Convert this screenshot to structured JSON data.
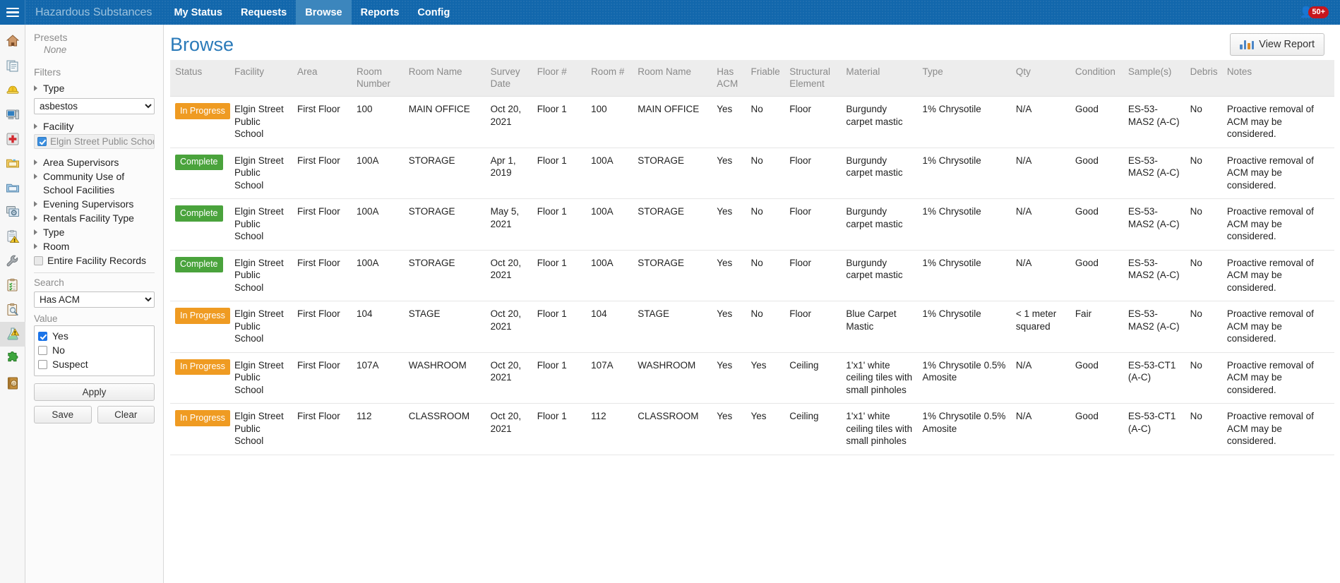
{
  "topbar": {
    "menu_icon": "hamburger-icon",
    "app_name": "Hazardous Substances",
    "nav": [
      {
        "label": "My Status",
        "active": false
      },
      {
        "label": "Requests",
        "active": false
      },
      {
        "label": "Browse",
        "active": true
      },
      {
        "label": "Reports",
        "active": false
      },
      {
        "label": "Config",
        "active": false
      }
    ],
    "user_badge": "50+",
    "brand_color": "#1267ac",
    "active_tab_color": "#3c86bd",
    "badge_color": "#c7161d"
  },
  "icon_rail": [
    {
      "name": "home-icon"
    },
    {
      "name": "documents-icon"
    },
    {
      "name": "hard-hat-icon"
    },
    {
      "name": "workstation-icon"
    },
    {
      "name": "first-aid-icon"
    },
    {
      "name": "yellow-folder-icon"
    },
    {
      "name": "blue-folder-icon"
    },
    {
      "name": "windows-settings-icon"
    },
    {
      "name": "clipboard-warning-icon"
    },
    {
      "name": "wrench-icon"
    },
    {
      "name": "clipboard-check-icon"
    },
    {
      "name": "clipboard-search-icon"
    },
    {
      "name": "hazard-flask-icon",
      "active": true
    },
    {
      "name": "puzzle-piece-icon"
    },
    {
      "name": "address-book-icon"
    }
  ],
  "filters": {
    "presets_heading": "Presets",
    "presets_value": "None",
    "filters_heading": "Filters",
    "type_node": "Type",
    "type_select_value": "asbestos",
    "type_select_options": [
      "asbestos"
    ],
    "facility_node": "Facility",
    "facility_selected": "Elgin Street Public School",
    "nodes": [
      "Area Supervisors",
      "Community Use of School Facilities",
      "Evening Supervisors",
      "Rentals Facility Type",
      "Type",
      "Room"
    ],
    "entire_facility_records": "Entire Facility Records",
    "search_label": "Search",
    "search_select_value": "Has ACM",
    "search_select_options": [
      "Has ACM"
    ],
    "value_label": "Value",
    "values": [
      {
        "label": "Yes",
        "checked": true
      },
      {
        "label": "No",
        "checked": false
      },
      {
        "label": "Suspect",
        "checked": false
      }
    ],
    "apply_label": "Apply",
    "save_label": "Save",
    "clear_label": "Clear"
  },
  "main": {
    "title": "Browse",
    "view_report_label": "View Report",
    "view_report_icon": "bar-chart-icon"
  },
  "table": {
    "columns": [
      "Status",
      "Facility",
      "Area",
      "Room Number",
      "Room Name",
      "Survey Date",
      "Floor #",
      "Room #",
      "Room Name",
      "Has ACM",
      "Friable",
      "Structural Element",
      "Material",
      "Type",
      "Qty",
      "Condition",
      "Sample(s)",
      "Debris",
      "Notes"
    ],
    "rows": [
      {
        "status": "In Progress",
        "status_kind": "inprogress",
        "facility": "Elgin Street Public School",
        "area": "First Floor",
        "room_number": "100",
        "room_name": "MAIN OFFICE",
        "survey_date": "Oct 20, 2021",
        "floor": "Floor 1",
        "room_hash": "100",
        "room_name2": "MAIN OFFICE",
        "has_acm": "Yes",
        "friable": "No",
        "structural_element": "Floor",
        "material": "Burgundy carpet mastic",
        "type": "1% Chrysotile",
        "qty": "N/A",
        "condition": "Good",
        "samples": "ES-53-MAS2 (A-C)",
        "debris": "No",
        "notes": "Proactive removal of ACM may be considered."
      },
      {
        "status": "Complete",
        "status_kind": "complete",
        "facility": "Elgin Street Public School",
        "area": "First Floor",
        "room_number": "100A",
        "room_name": "STORAGE",
        "survey_date": "Apr 1, 2019",
        "floor": "Floor 1",
        "room_hash": "100A",
        "room_name2": "STORAGE",
        "has_acm": "Yes",
        "friable": "No",
        "structural_element": "Floor",
        "material": "Burgundy carpet mastic",
        "type": "1% Chrysotile",
        "qty": "N/A",
        "condition": "Good",
        "samples": "ES-53-MAS2 (A-C)",
        "debris": "No",
        "notes": "Proactive removal of ACM may be considered."
      },
      {
        "status": "Complete",
        "status_kind": "complete",
        "facility": "Elgin Street Public School",
        "area": "First Floor",
        "room_number": "100A",
        "room_name": "STORAGE",
        "survey_date": "May 5, 2021",
        "floor": "Floor 1",
        "room_hash": "100A",
        "room_name2": "STORAGE",
        "has_acm": "Yes",
        "friable": "No",
        "structural_element": "Floor",
        "material": "Burgundy carpet mastic",
        "type": "1% Chrysotile",
        "qty": "N/A",
        "condition": "Good",
        "samples": "ES-53-MAS2 (A-C)",
        "debris": "No",
        "notes": "Proactive removal of ACM may be considered."
      },
      {
        "status": "Complete",
        "status_kind": "complete",
        "facility": "Elgin Street Public School",
        "area": "First Floor",
        "room_number": "100A",
        "room_name": "STORAGE",
        "survey_date": "Oct 20, 2021",
        "floor": "Floor 1",
        "room_hash": "100A",
        "room_name2": "STORAGE",
        "has_acm": "Yes",
        "friable": "No",
        "structural_element": "Floor",
        "material": "Burgundy carpet mastic",
        "type": "1% Chrysotile",
        "qty": "N/A",
        "condition": "Good",
        "samples": "ES-53-MAS2 (A-C)",
        "debris": "No",
        "notes": "Proactive removal of ACM may be considered."
      },
      {
        "status": "In Progress",
        "status_kind": "inprogress",
        "facility": "Elgin Street Public School",
        "area": "First Floor",
        "room_number": "104",
        "room_name": "STAGE",
        "survey_date": "Oct 20, 2021",
        "floor": "Floor 1",
        "room_hash": "104",
        "room_name2": "STAGE",
        "has_acm": "Yes",
        "friable": "No",
        "structural_element": "Floor",
        "material": "Blue Carpet Mastic",
        "type": "1% Chrysotile",
        "qty": "< 1 meter squared",
        "condition": "Fair",
        "samples": "ES-53-MAS2 (A-C)",
        "debris": "No",
        "notes": "Proactive removal of ACM may be considered."
      },
      {
        "status": "In Progress",
        "status_kind": "inprogress",
        "facility": "Elgin Street Public School",
        "area": "First Floor",
        "room_number": "107A",
        "room_name": "WASHROOM",
        "survey_date": "Oct 20, 2021",
        "floor": "Floor 1",
        "room_hash": "107A",
        "room_name2": "WASHROOM",
        "has_acm": "Yes",
        "friable": "Yes",
        "structural_element": "Ceiling",
        "material": "1'x1' white ceiling tiles with small pinholes",
        "type": "1% Chrysotile 0.5% Amosite",
        "qty": "N/A",
        "condition": "Good",
        "samples": "ES-53-CT1 (A-C)",
        "debris": "No",
        "notes": "Proactive removal of ACM may be considered."
      },
      {
        "status": "In Progress",
        "status_kind": "inprogress",
        "facility": "Elgin Street Public School",
        "area": "First Floor",
        "room_number": "112",
        "room_name": "CLASSROOM",
        "survey_date": "Oct 20, 2021",
        "floor": "Floor 1",
        "room_hash": "112",
        "room_name2": "CLASSROOM",
        "has_acm": "Yes",
        "friable": "Yes",
        "structural_element": "Ceiling",
        "material": "1'x1' white ceiling tiles with small pinholes",
        "type": "1% Chrysotile 0.5% Amosite",
        "qty": "N/A",
        "condition": "Good",
        "samples": "ES-53-CT1 (A-C)",
        "debris": "No",
        "notes": "Proactive removal of ACM may be considered."
      }
    ]
  }
}
